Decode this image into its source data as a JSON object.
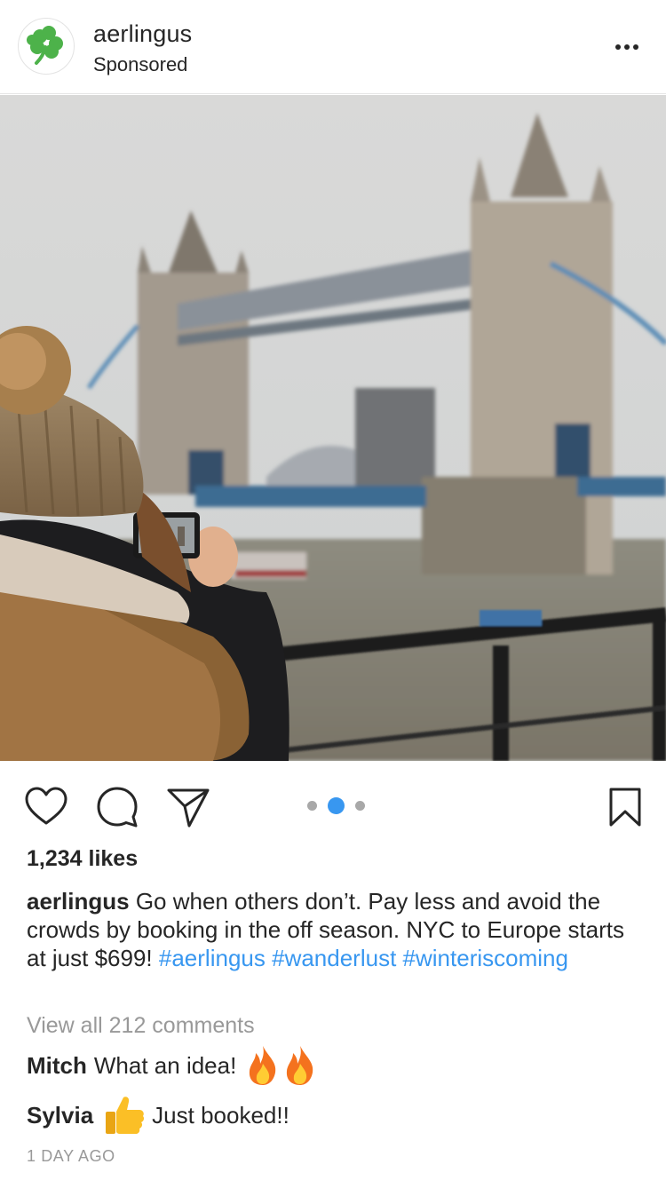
{
  "post": {
    "username": "aerlingus",
    "sponsored_label": "Sponsored",
    "avatar_icon": "shamrock-icon",
    "brand_color": "#4db24a"
  },
  "media": {
    "description_icon": "photo",
    "carousel": {
      "count": 3,
      "active_index": 1
    }
  },
  "actions": {
    "icons": [
      "heart-icon",
      "comment-icon",
      "share-icon",
      "bookmark-icon"
    ]
  },
  "likes": "1,234 likes",
  "caption": {
    "username": "aerlingus",
    "text_line1": "Go when others don’t. Pay less and avoid",
    "text_line2": "the crowds by booking in the off season. NYC to",
    "text_line3": "Europe starts at just $699!",
    "hashtags": [
      "#aerlingus",
      "#wanderlust",
      "#winteriscoming"
    ],
    "hashtag_color": "#3897f0"
  },
  "view_all_comments": "View all 212 comments",
  "comments": [
    {
      "username": "Mitch",
      "text": "What an idea!",
      "emoji": "fire-emoji fire-emoji"
    },
    {
      "username": "Sylvia",
      "text": "Just booked!!",
      "emoji": "thumbs-up-emoji"
    }
  ],
  "timestamp": "1 DAY AGO"
}
